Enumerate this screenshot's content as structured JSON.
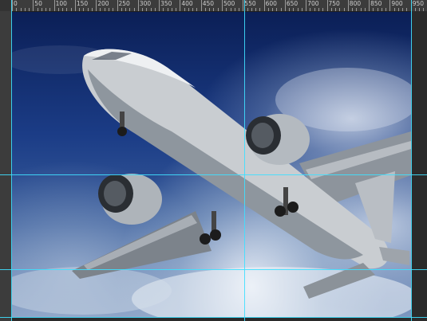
{
  "ruler": {
    "labels": [
      "0",
      "50",
      "100",
      "150",
      "200",
      "250",
      "300",
      "350",
      "400",
      "450",
      "500",
      "550",
      "600",
      "650",
      "700",
      "750",
      "800",
      "850",
      "900",
      "950"
    ]
  },
  "canvas": {
    "subject": "jet airplane photo",
    "sky_color": "#1b3c86"
  },
  "guides": {
    "color": "#3fe0ff",
    "horizontal_count": 3,
    "vertical_count": 3
  }
}
